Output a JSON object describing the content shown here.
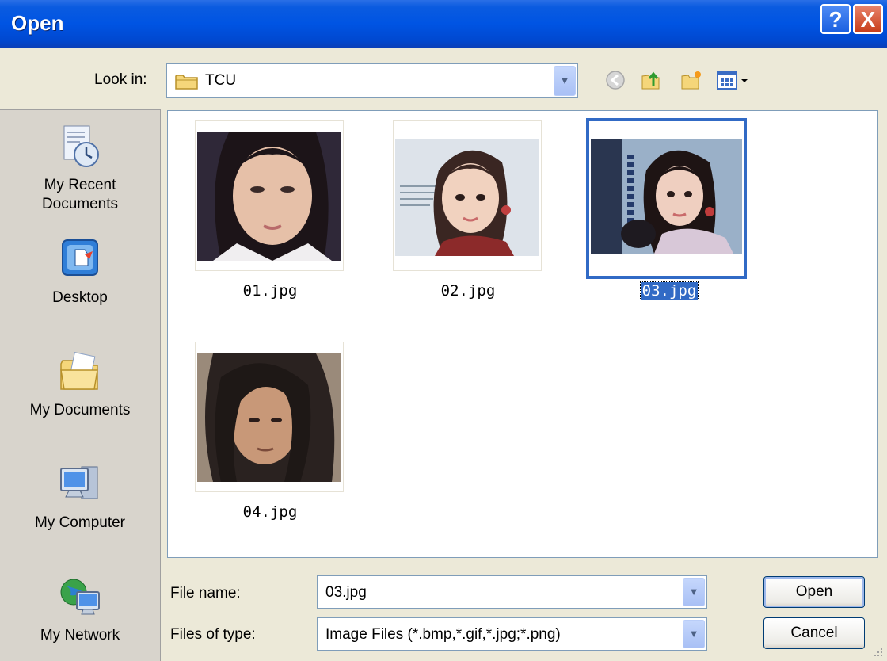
{
  "window": {
    "title": "Open",
    "help_label": "?",
    "close_label": "X"
  },
  "toolbar": {
    "look_in_label": "Look in:",
    "look_in_value": "TCU",
    "tools": [
      "back-icon",
      "up-folder-icon",
      "new-folder-icon",
      "views-menu-icon"
    ]
  },
  "places": [
    {
      "label": "My Recent\nDocuments",
      "line1": "My Recent",
      "line2": "Documents",
      "icon": "recent-documents-icon"
    },
    {
      "label": "Desktop",
      "icon": "desktop-icon"
    },
    {
      "label": "My Documents",
      "icon": "my-documents-icon"
    },
    {
      "label": "My Computer",
      "icon": "my-computer-icon"
    },
    {
      "label": "My Network",
      "icon": "my-network-icon"
    }
  ],
  "files": [
    {
      "name": "01.jpg",
      "selected": false
    },
    {
      "name": "02.jpg",
      "selected": false
    },
    {
      "name": "03.jpg",
      "selected": true
    },
    {
      "name": "04.jpg",
      "selected": false
    }
  ],
  "form": {
    "file_name_label": "File name:",
    "file_name_value": "03.jpg",
    "file_type_label": "Files of type:",
    "file_type_value": "Image Files (*.bmp,*.gif,*.jpg;*.png)"
  },
  "buttons": {
    "open": "Open",
    "cancel": "Cancel"
  },
  "colors": {
    "title_bar": "#0054e3",
    "selection": "#316ac5",
    "dialog_bg": "#ece9d8"
  }
}
